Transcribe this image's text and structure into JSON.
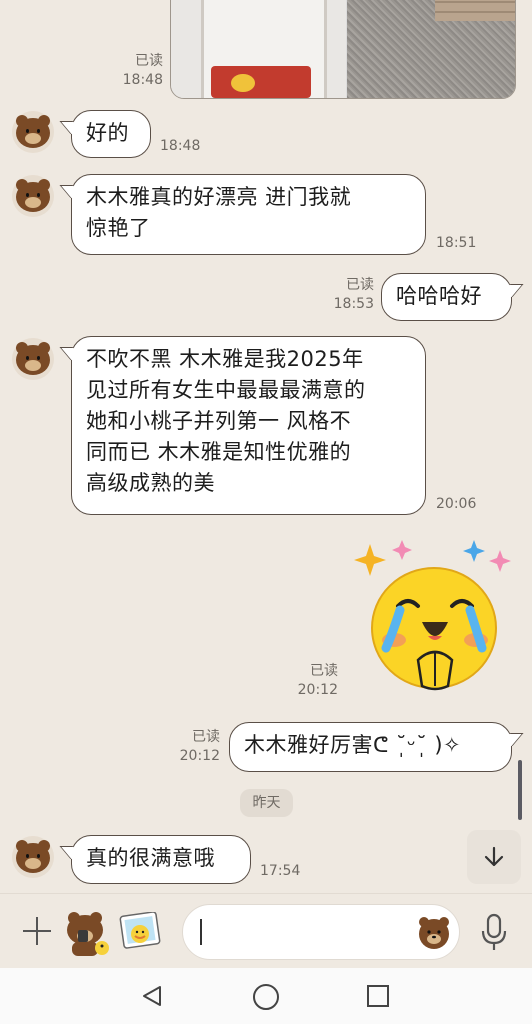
{
  "messages": [
    {
      "id": "m0",
      "type": "image",
      "read": "已读",
      "time": "18:48"
    },
    {
      "id": "m1",
      "type": "text",
      "side": "in",
      "text": "好的",
      "time": "18:48"
    },
    {
      "id": "m2",
      "type": "text",
      "side": "in",
      "lines": [
        "木木雅真的好漂亮 进门我就",
        "惊艳了"
      ],
      "time": "18:51"
    },
    {
      "id": "m3",
      "type": "text",
      "side": "out",
      "text": "哈哈哈好",
      "read": "已读",
      "time": "18:53"
    },
    {
      "id": "m4",
      "type": "text",
      "side": "in",
      "lines": [
        "不吹不黑 木木雅是我2025年",
        "见过所有女生中最最最满意的",
        "她和小桃子并列第一 风格不",
        "同而已 木木雅是知性优雅的",
        "高级成熟的美"
      ],
      "time": "20:06"
    },
    {
      "id": "m5",
      "type": "sticker",
      "side": "out",
      "read": "已读",
      "time": "20:12"
    },
    {
      "id": "m6",
      "type": "text",
      "side": "out",
      "text": "木木雅好厉害ᕦ ˘̩ᵕ˘̩ )✧",
      "read": "已读",
      "time": "20:12"
    },
    {
      "id": "m7",
      "type": "text",
      "side": "in",
      "text": "真的很满意哦",
      "time": "17:54"
    }
  ],
  "date_separator": "昨天",
  "input": {
    "placeholder": ""
  },
  "icons": {
    "plus": "plus-icon",
    "emoji": "bear-emoji-icon",
    "sticker": "sticker-icon",
    "bear": "bear-face-icon",
    "mic": "microphone-icon",
    "down": "arrow-down-icon"
  },
  "colors": {
    "background": "#efe9e1",
    "bubble": "#ffffff",
    "bubble_border": "#5a4f47",
    "meta_text": "#6f6a64"
  }
}
